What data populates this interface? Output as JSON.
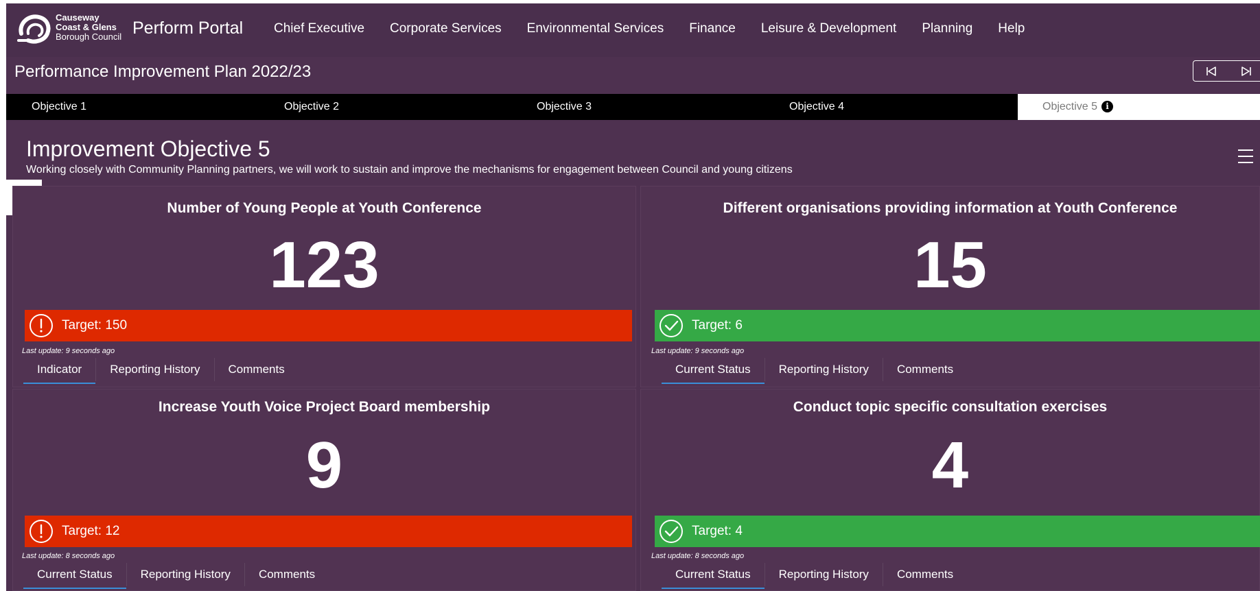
{
  "header": {
    "logo": {
      "line1": "Causeway",
      "line2": "Coast & Glens",
      "line3": "Borough Council"
    },
    "portal_title": "Perform Portal",
    "nav": [
      "Chief Executive",
      "Corporate Services",
      "Environmental Services",
      "Finance",
      "Leisure & Development",
      "Planning",
      "Help"
    ]
  },
  "plan_title": "Performance Improvement Plan 2022/23",
  "pager": {
    "prev_icon": "skip-previous-icon",
    "next_icon": "skip-next-icon"
  },
  "tabs": [
    {
      "label": "Objective 1"
    },
    {
      "label": "Objective 2"
    },
    {
      "label": "Objective 3"
    },
    {
      "label": "Objective 4"
    },
    {
      "label": "Objective 5",
      "active": true
    }
  ],
  "objective": {
    "title": "Improvement Objective 5",
    "description": "Working closely with Community Planning partners, we will work to sustain and improve the mechanisms for engagement between Council and young citizens"
  },
  "panels": [
    {
      "title": "Number of Young People at Youth Conference",
      "value": "123",
      "target": "Target: 150",
      "status": "warning",
      "last_update": "Last update: 9 seconds ago",
      "tabs": [
        "Indicator",
        "Reporting History",
        "Comments"
      ]
    },
    {
      "title": "Different organisations providing information at Youth Conference",
      "value": "15",
      "target": "Target: 6",
      "status": "ok",
      "last_update": "Last update: 9 seconds ago",
      "tabs": [
        "Current Status",
        "Reporting History",
        "Comments"
      ]
    },
    {
      "title": "Increase Youth Voice Project Board membership",
      "value": "9",
      "target": "Target: 12",
      "status": "warning",
      "last_update": "Last update: 8 seconds ago",
      "tabs": [
        "Current Status",
        "Reporting History",
        "Comments"
      ]
    },
    {
      "title": "Conduct topic specific consultation exercises",
      "value": "4",
      "target": "Target: 4",
      "status": "ok",
      "last_update": "Last update: 8 seconds ago",
      "tabs": [
        "Current Status",
        "Reporting History",
        "Comments"
      ]
    }
  ],
  "colors": {
    "background": "#4e3150",
    "warning": "#de2900",
    "ok": "#35a946",
    "tab_bar": "#000000",
    "selected_underline": "#3a8fd8"
  }
}
